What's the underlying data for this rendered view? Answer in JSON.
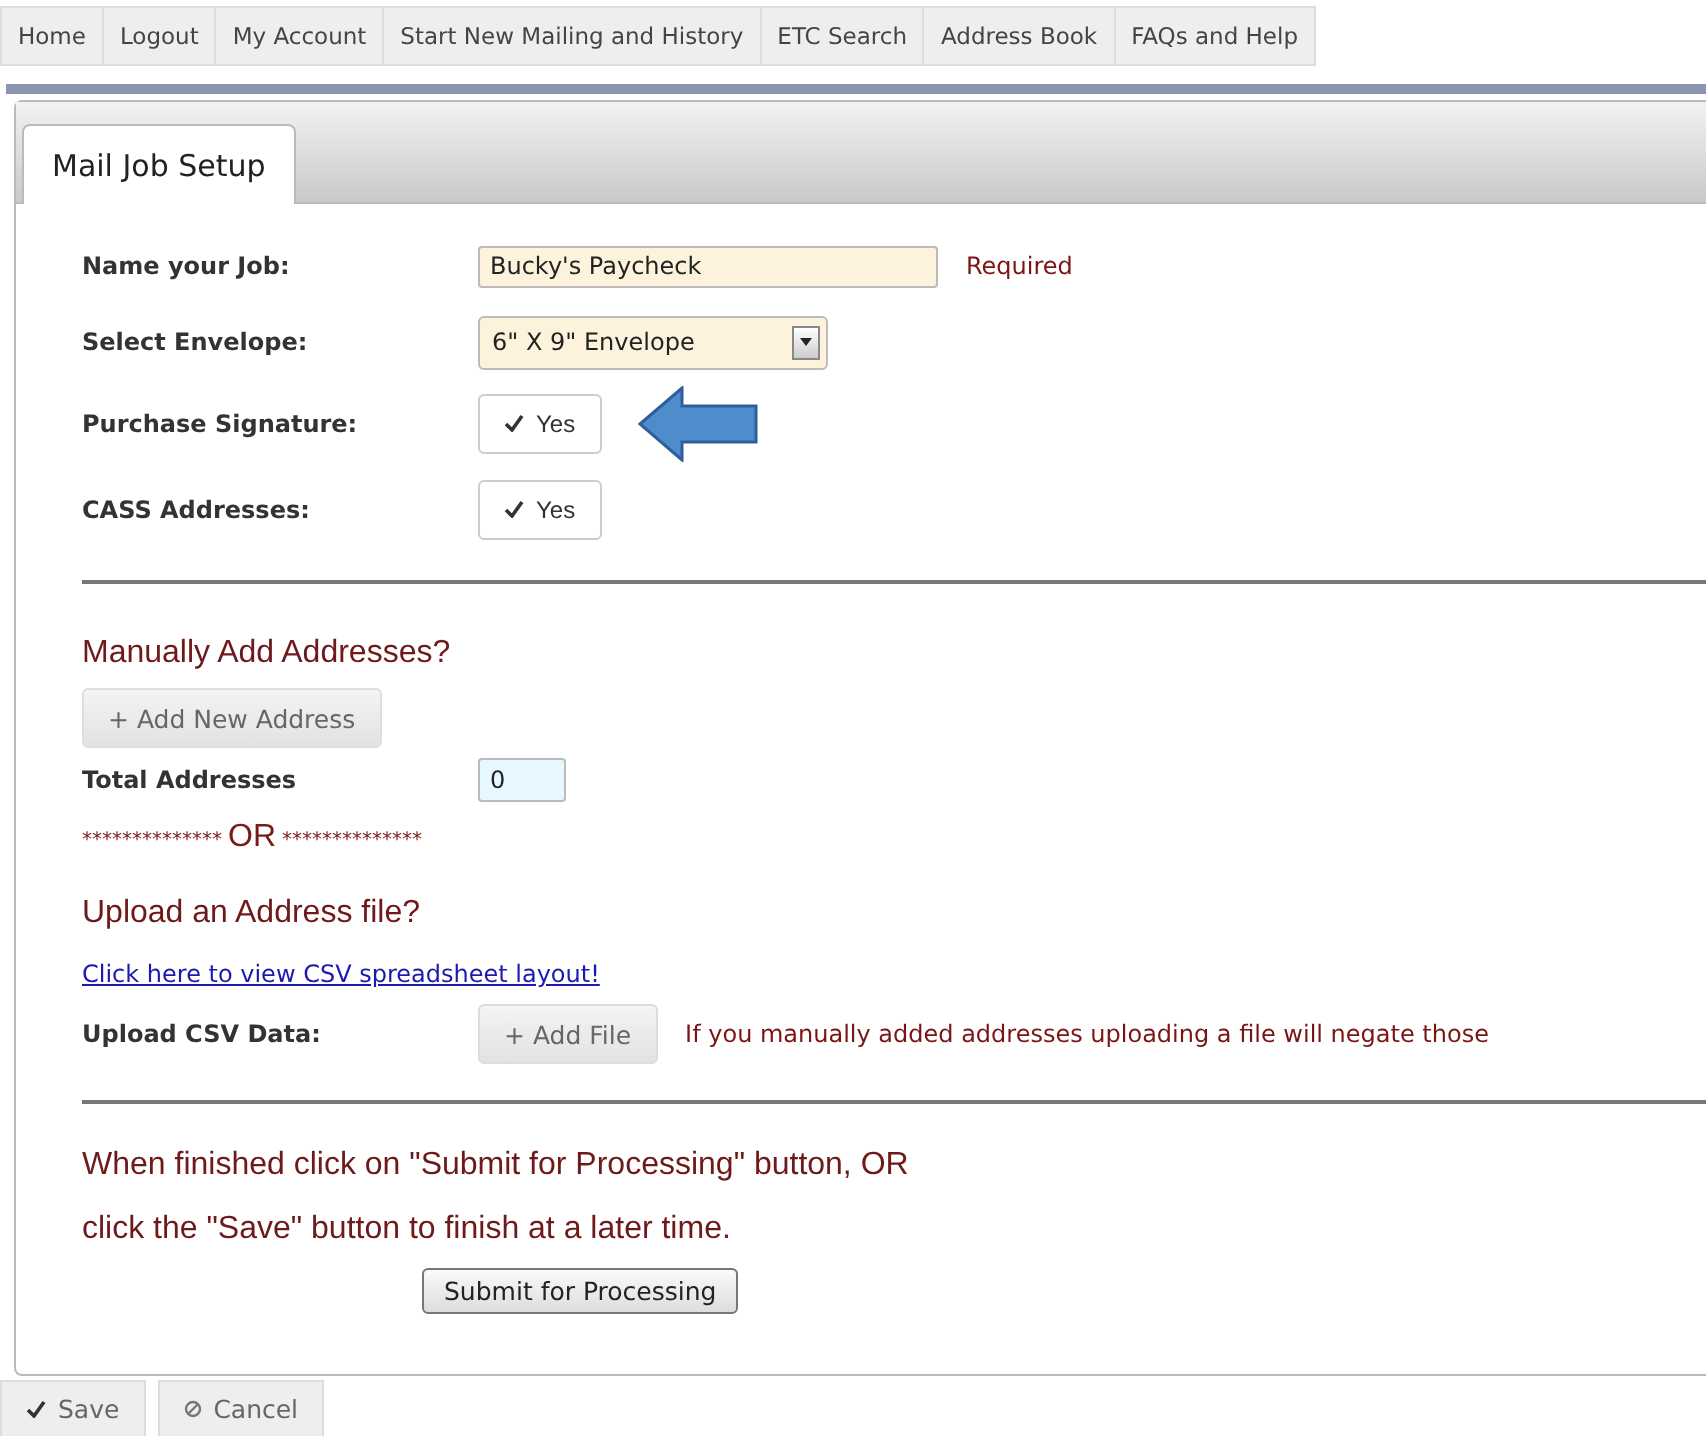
{
  "nav": [
    "Home",
    "Logout",
    "My Account",
    "Start New Mailing and History",
    "ETC Search",
    "Address Book",
    "FAQs and Help"
  ],
  "tab": {
    "label": "Mail Job Setup",
    "selected": true
  },
  "job_name": {
    "label": "Name your Job:",
    "value": "Bucky's Paycheck",
    "note": "Required"
  },
  "envelope": {
    "label": "Select Envelope:",
    "value": "6\" X 9\" Envelope"
  },
  "toggles": [
    {
      "label": "Purchase Signature:",
      "text": "Yes",
      "checked": true,
      "arrow": true
    },
    {
      "label": "CASS Addresses:",
      "text": "Yes",
      "checked": true,
      "arrow": false
    }
  ],
  "manual": {
    "heading": "Manually Add Addresses?",
    "button": "+ Add New Address",
    "total_label": "Total Addresses",
    "total_value": "0",
    "separator_left": "**************",
    "separator_or": "OR",
    "separator_right": "**************"
  },
  "upload": {
    "heading": "Upload an Address file?",
    "link": "Click here to view CSV spreadsheet layout!",
    "label": "Upload CSV Data:",
    "button": "+ Add File",
    "note": "If you manually added addresses uploading a file will negate those"
  },
  "instructions": [
    "When finished click on \"Submit for Processing\" button, OR",
    "click the \"Save\" button to finish at a later time."
  ],
  "submit": "Submit for Processing",
  "footer_buttons": [
    {
      "kind": "save",
      "label": "Save"
    },
    {
      "kind": "cancel",
      "label": "Cancel"
    }
  ]
}
